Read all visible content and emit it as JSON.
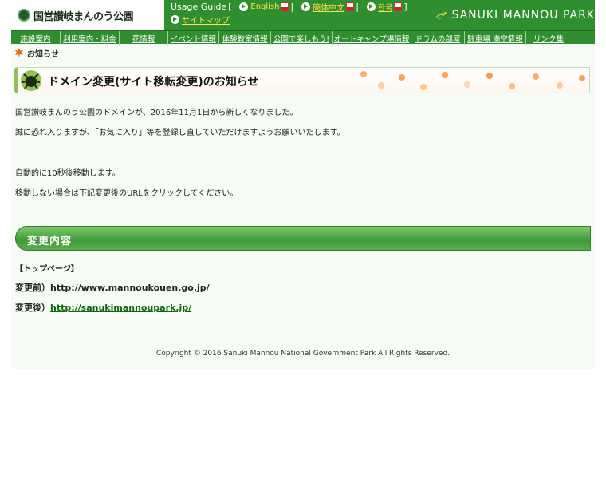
{
  "header": {
    "logo_text": "国営讃岐まんのう公園",
    "usage_guide_label": "Usage Guide",
    "bracket_open": "[",
    "bracket_close": "]",
    "languages": [
      {
        "label": "English",
        "icon": "pdf-icon"
      },
      {
        "label": "簡体中文",
        "icon": "pdf-icon"
      },
      {
        "label": "한국",
        "icon": "pdf-icon"
      }
    ],
    "sitemap_label": "サイトマップ",
    "brand_text": "SANUKI MANNOU PARK"
  },
  "nav": {
    "items": [
      {
        "label": "施設案内"
      },
      {
        "label": "利用案内・料金"
      },
      {
        "label": "花情報"
      },
      {
        "label": "イベント情報"
      },
      {
        "label": "体験教室情報"
      },
      {
        "label": "公園で楽しもう!"
      },
      {
        "label": "オートキャンプ場情報"
      },
      {
        "label": "ドラムの部屋"
      },
      {
        "label": "駐車場 満空情報"
      },
      {
        "label": "リンク集"
      }
    ]
  },
  "breadcrumb": {
    "label": "お知らせ"
  },
  "notice": {
    "title": "ドメイン変更(サイト移転変更)のお知らせ",
    "line1": "国営讃岐まんのう公園のドメインが、2016年11月1日から新しくなりました。",
    "line2": "誠に恐れ入りますが、「お気に入り」等を登録し直していただけますようお願いいたします。",
    "line3": "自動的に10秒後移動します。",
    "line4": "移動しない場合は下記変更後のURLをクリックしてください。"
  },
  "changes": {
    "section_title": "変更内容",
    "page_label": "【トップページ】",
    "before_label": "変更前）",
    "before_url": "http://www.mannoukouen.go.jp/",
    "after_label": "変更後）",
    "after_url": "http://sanukimannoupark.jp/"
  },
  "footer": {
    "copyright": "Copyright © 2016 Sanuki Mannou National Government Park All Rights Reserved."
  },
  "colors": {
    "header_green": "#2f8e2f",
    "link_yellow": "#ffe14a",
    "section_green": "#3e9a3a",
    "url_link": "#0b6b0b"
  }
}
